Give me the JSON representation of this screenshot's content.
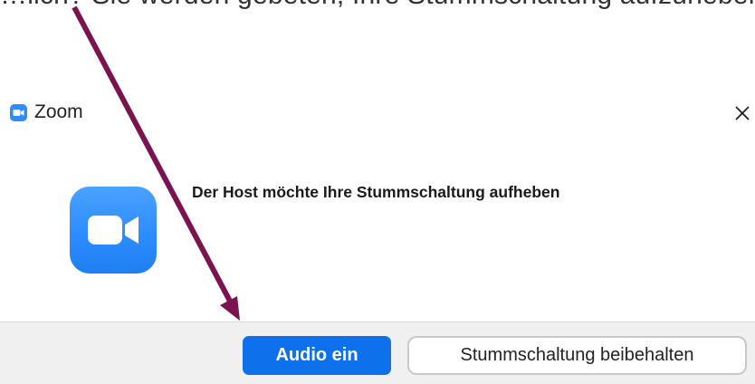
{
  "top_caption": "…lich? Sie werden gebeten, Ihre Stummschaltung aufzuheben",
  "window": {
    "title": "Zoom",
    "app_icon": "zoom-camera-icon",
    "close_icon": "close-icon"
  },
  "dialog": {
    "message": "Der Host möchte Ihre Stummschaltung aufheben",
    "icon": "zoom-camera-icon"
  },
  "buttons": {
    "primary_label": "Audio ein",
    "secondary_label": "Stummschaltung beibehalten"
  },
  "colors": {
    "accent": "#2D8CFF",
    "primary_button": "#0E71EB",
    "annotation_arrow": "#7B1350",
    "footer_background": "#F0F0F0"
  }
}
